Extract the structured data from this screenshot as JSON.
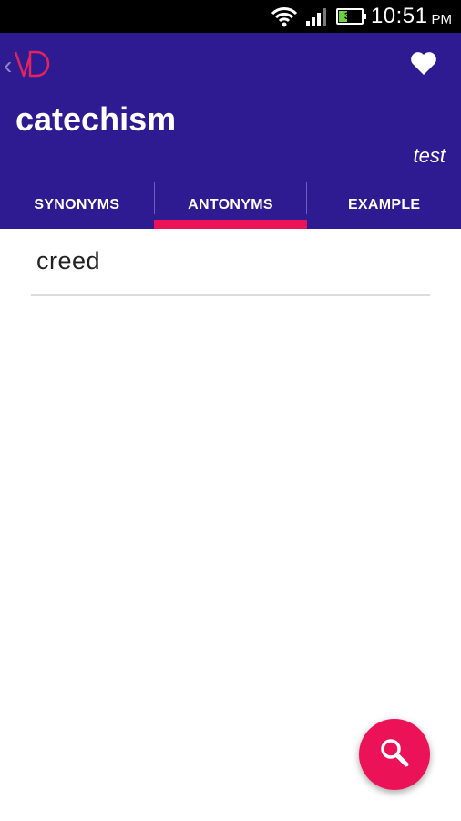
{
  "status_bar": {
    "time": "10:51",
    "ampm": "PM",
    "battery_level": "37",
    "icons": [
      "wifi-icon",
      "signal-icon",
      "battery-icon"
    ]
  },
  "header": {
    "logo_text": "VD",
    "word": "catechism",
    "category": "test"
  },
  "tabs": [
    {
      "label": "SYNONYMS"
    },
    {
      "label": "ANTONYMS",
      "active": true
    },
    {
      "label": "EXAMPLE"
    }
  ],
  "results": [
    {
      "text": "creed"
    }
  ],
  "colors": {
    "header_bg": "#2f1b91",
    "accent": "#ec1257",
    "logo": "#e0245e"
  }
}
